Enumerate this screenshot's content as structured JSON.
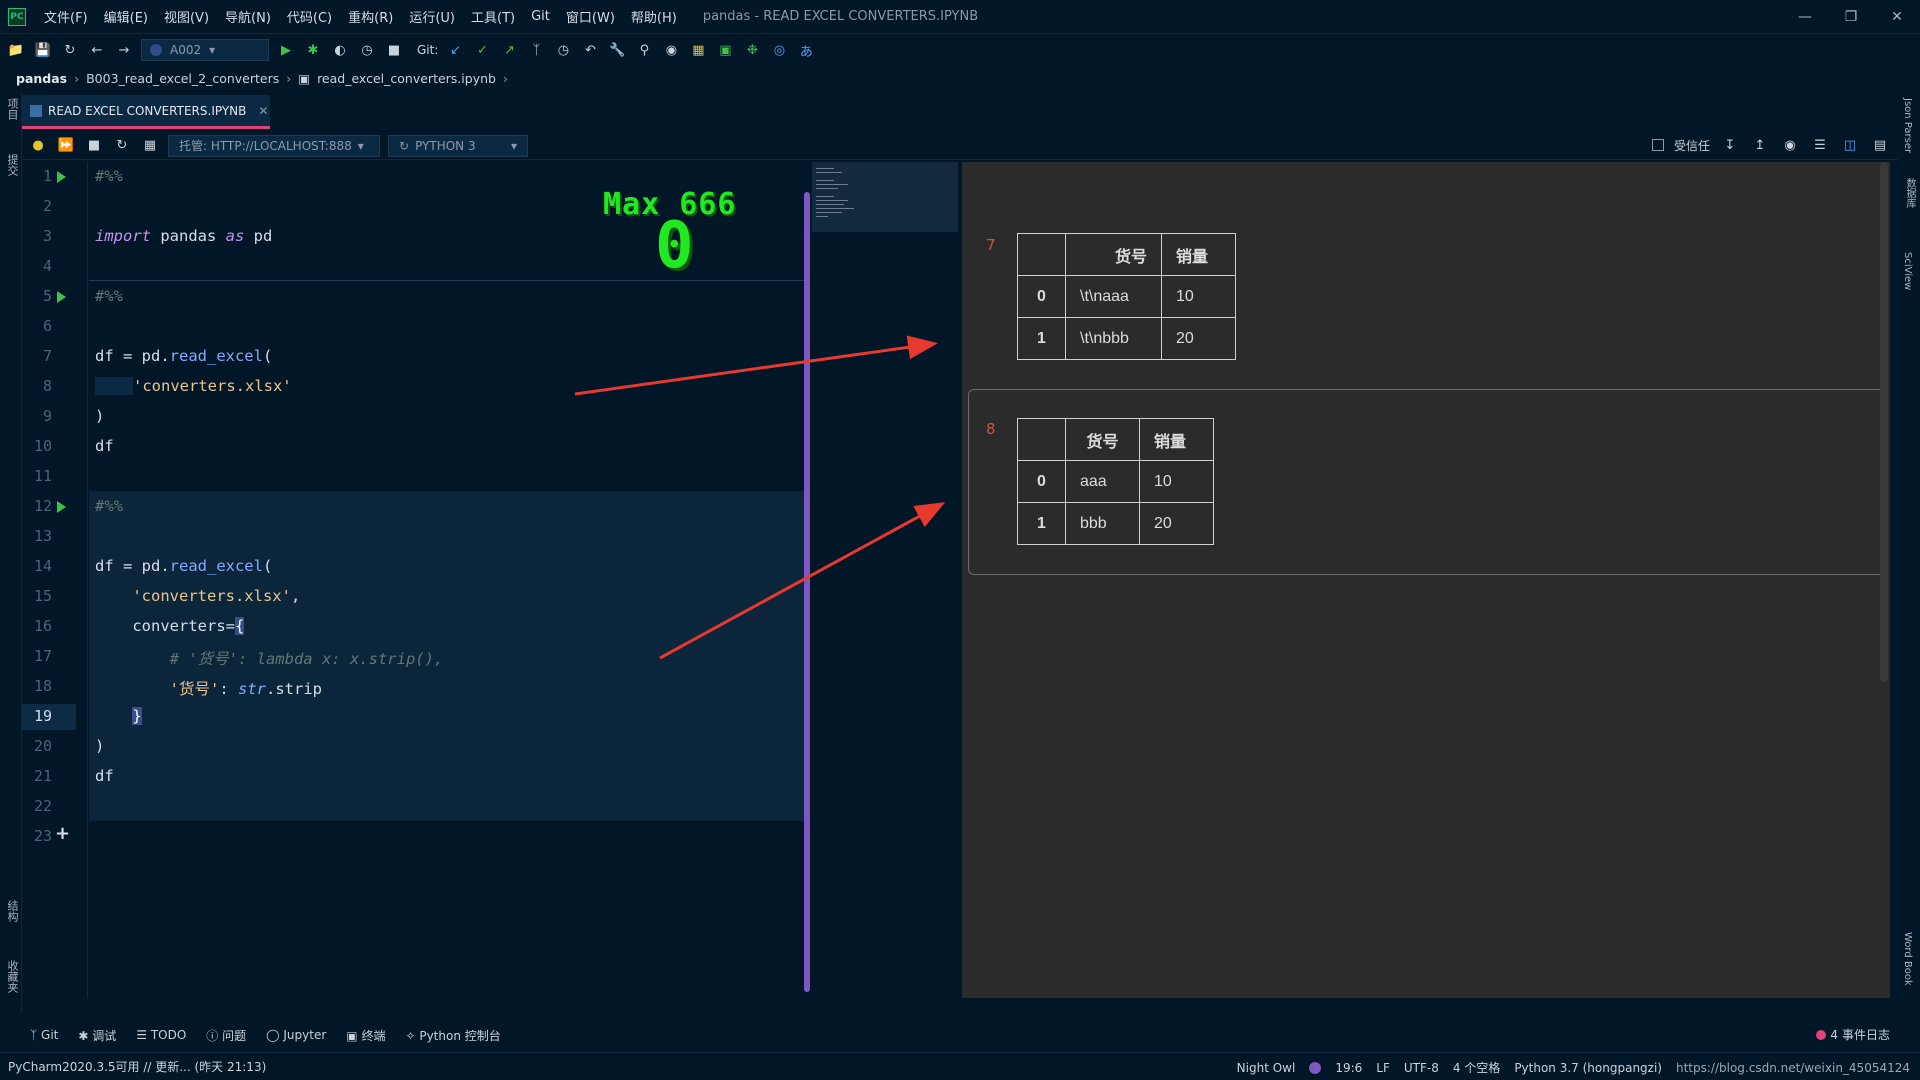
{
  "menu": {
    "logo": "PC",
    "items": [
      "文件(F)",
      "编辑(E)",
      "视图(V)",
      "导航(N)",
      "代码(C)",
      "重构(R)",
      "运行(U)",
      "工具(T)",
      "Git",
      "窗口(W)",
      "帮助(H)"
    ],
    "title": "pandas - READ EXCEL CONVERTERS.IPYNB"
  },
  "toolbar": {
    "run_config": "A002",
    "git_label": "Git:"
  },
  "breadcrumb": [
    "pandas",
    "B003_read_excel_2_converters",
    "read_excel_converters.ipynb"
  ],
  "left_strip": [
    "项目",
    "提交",
    "结构",
    "收藏夹"
  ],
  "right_strip": [
    "Json Parser",
    "数据库",
    "SciView",
    "Word Book"
  ],
  "tab": {
    "label": "READ EXCEL CONVERTERS.IPYNB"
  },
  "notebook_toolbar": {
    "server": "托管: HTTP://LOCALHOST:888",
    "kernel": "PYTHON 3",
    "trusted": "受信任"
  },
  "overlay": {
    "line1": "Max 666",
    "line2": "0"
  },
  "line_numbers": [
    "1",
    "2",
    "3",
    "4",
    "5",
    "6",
    "7",
    "8",
    "9",
    "10",
    "11",
    "12",
    "13",
    "14",
    "15",
    "16",
    "17",
    "18",
    "19",
    "20",
    "21",
    "22",
    "23"
  ],
  "code": {
    "l1": "#%%",
    "l3_kw1": "import",
    "l3_mod": " pandas ",
    "l3_kw2": "as",
    "l3_alias": " pd",
    "l5": "#%%",
    "l7_a": "df = pd.",
    "l7_fn": "read_excel",
    "l7_b": "(",
    "l8": "'converters.xlsx'",
    "l9": ")",
    "l10": "df",
    "l12": "#%%",
    "l14_a": "df = pd.",
    "l14_fn": "read_excel",
    "l14_b": "(",
    "l15": "'converters.xlsx'",
    "l15_c": ",",
    "l16_a": "converters=",
    "l16_b": "{",
    "l17": "# '货号': lambda x: x.strip(),",
    "l18_key": "'货号'",
    "l18_colon": ": ",
    "l18_bi": "str",
    "l18_rest": ".strip",
    "l19": "}",
    "l20": ")",
    "l21": "df"
  },
  "outputs": [
    {
      "num": "7",
      "headers": [
        "",
        "货号",
        "销量"
      ],
      "rows": [
        [
          "0",
          "\\t\\naaa",
          "10"
        ],
        [
          "1",
          "\\t\\nbbb",
          "20"
        ]
      ]
    },
    {
      "num": "8",
      "headers": [
        "",
        "货号",
        "销量"
      ],
      "rows": [
        [
          "0",
          "aaa",
          "10"
        ],
        [
          "1",
          "bbb",
          "20"
        ]
      ]
    }
  ],
  "bottom_tools": [
    "Git",
    "调试",
    "TODO",
    "问题",
    "Jupyter",
    "终端",
    "Python 控制台"
  ],
  "event_log": {
    "count": "4",
    "label": "事件日志"
  },
  "status": {
    "left": "PyCharm2020.3.5可用 // 更新... (昨天 21:13)",
    "theme": "Night Owl",
    "position": "19:6",
    "line_sep": "LF",
    "encoding": "UTF-8",
    "indent": "4 个空格",
    "interpreter": "Python 3.7 (hongpangzi)",
    "watermark": "https://blog.csdn.net/weixin_45054124"
  },
  "colors": {
    "accent": "#e0427a",
    "run_green": "#3ec24a",
    "overlay_green": "#22e822",
    "annotation_arrow": "#e8392f"
  }
}
